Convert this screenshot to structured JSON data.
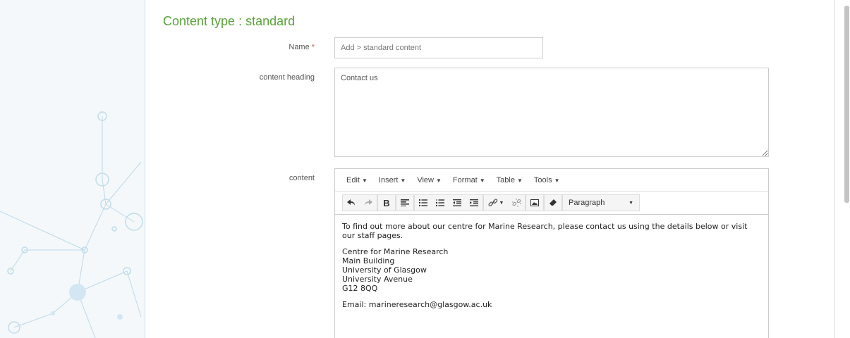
{
  "page": {
    "title": "Content type : standard"
  },
  "form": {
    "name": {
      "label": "Name",
      "required_mark": "*",
      "value": "Add > standard content"
    },
    "content_heading": {
      "label": "content heading",
      "value": "Contact us"
    },
    "content": {
      "label": "content"
    }
  },
  "editor": {
    "menu": [
      {
        "label": "Edit"
      },
      {
        "label": "Insert"
      },
      {
        "label": "View"
      },
      {
        "label": "Format"
      },
      {
        "label": "Table"
      },
      {
        "label": "Tools"
      }
    ],
    "format_select": "Paragraph",
    "body": {
      "intro": "To find out more about our centre for Marine Research, please contact us using the details below or visit our staff pages.",
      "address": [
        "Centre for Marine Research",
        "Main Building",
        "University of Glasgow",
        "University Avenue",
        "G12 8QQ"
      ],
      "email": "Email: marineresearch@glasgow.ac.uk"
    }
  },
  "colors": {
    "accent": "#5aa33a",
    "required": "#d9534f"
  }
}
